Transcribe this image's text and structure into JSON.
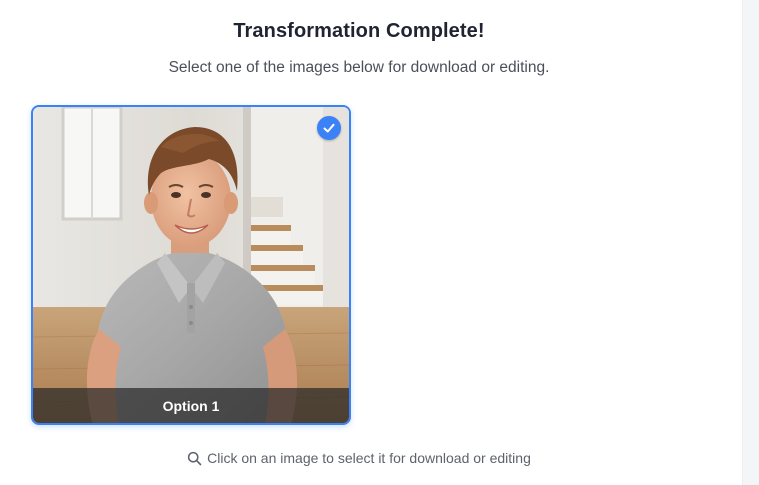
{
  "header": {
    "title": "Transformation Complete!",
    "subtitle": "Select one of the images below for download or editing."
  },
  "results": [
    {
      "caption": "Option 1",
      "selected": true,
      "selected_icon": "check-icon"
    }
  ],
  "hint": {
    "icon": "search-icon",
    "text": "Click on an image to select it for download or editing"
  },
  "colors": {
    "accent": "#3b82f6",
    "title": "#1f2430",
    "muted_text": "#5d626c"
  }
}
